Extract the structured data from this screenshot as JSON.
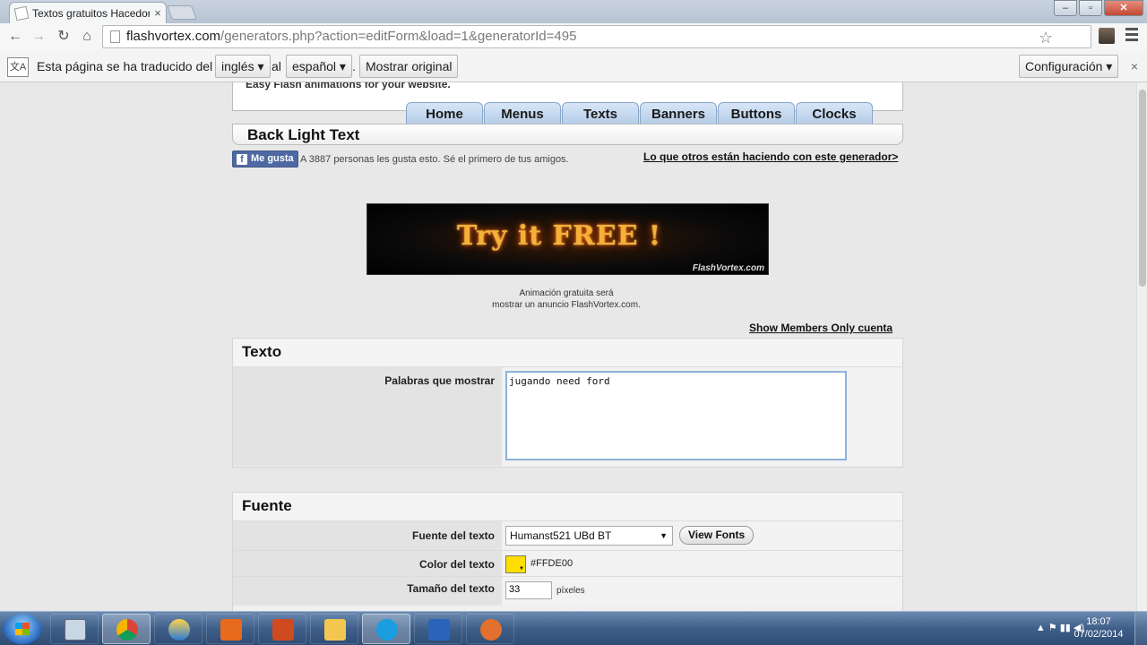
{
  "browser": {
    "tab_title": "Textos gratuitos Hacedor,",
    "tab_close": "×",
    "url_domain": "flashvortex.com",
    "url_path": "/generators.php?action=editForm&load=1&generatorId=495",
    "star": "☆"
  },
  "translate_bar": {
    "lead": "Esta página se ha traducido del",
    "from_lang": "inglés",
    "connector": "al",
    "to_lang": "español",
    "dot": ".",
    "show_original": "Mostrar original",
    "settings": "Configuración",
    "close": "×",
    "icon_text": "文A"
  },
  "site": {
    "header_tagline": "Easy Flash animations for your website.",
    "nav": [
      "Home",
      "Menus",
      "Texts",
      "Banners",
      "Buttons",
      "Clocks"
    ],
    "page_title": "Back Light Text",
    "fb_like_label": "Me gusta",
    "fb_like_icon": "f",
    "fb_text": "A 3887 personas les gusta esto. Sé el primero de tus amigos.",
    "others_link": "Lo que otros están haciendo con este generador>",
    "ad_main": "Try it FREE !",
    "ad_brand": "FlashVortex.com",
    "ad_caption_1": "Animación gratuita será",
    "ad_caption_2": "mostrar un anuncio FlashVortex.com.",
    "members_link": "Show Members Only cuenta"
  },
  "form": {
    "texto_section": "Texto",
    "words_label": "Palabras que mostrar",
    "words_value": "jugando need ford",
    "fuente_section": "Fuente",
    "font_label": "Fuente del texto",
    "font_value": "Humanst521 UBd BT",
    "view_fonts": "View Fonts",
    "color_label": "Color del texto",
    "color_value": "#FFDE00",
    "size_label": "Tamaño del texto",
    "size_value": "33",
    "size_unit": "píxeles"
  },
  "taskbar": {
    "time": "18:07",
    "date": "07/02/2014"
  }
}
